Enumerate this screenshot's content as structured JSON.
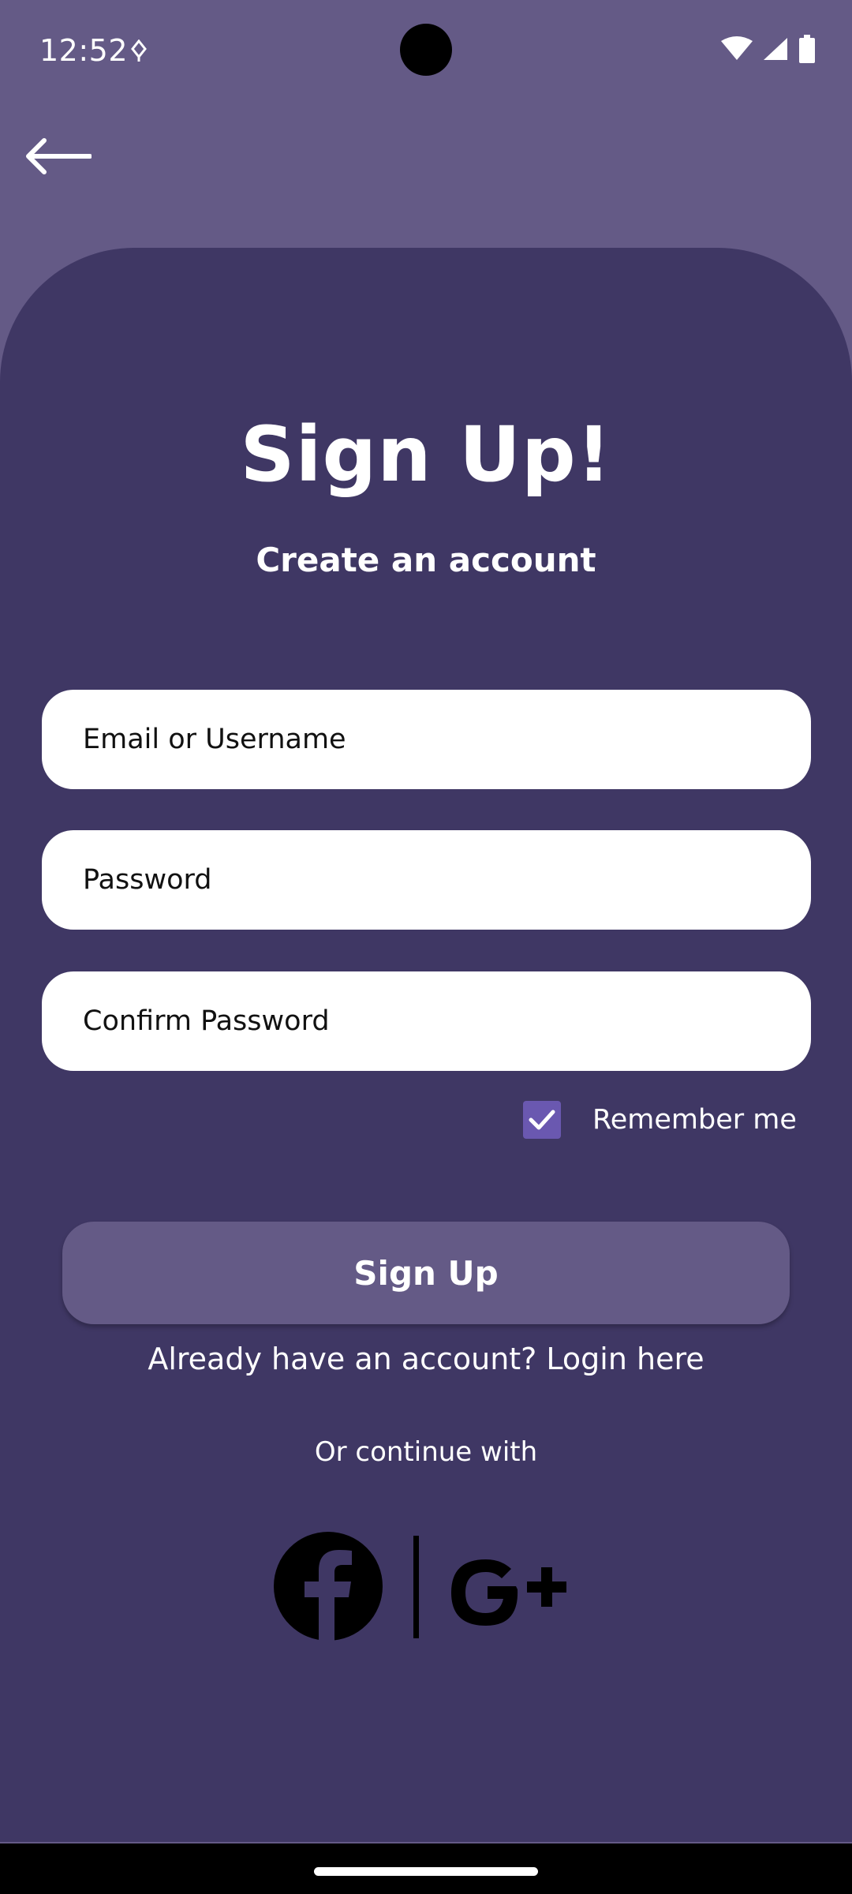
{
  "status_bar": {
    "time": "12:52"
  },
  "header": {
    "back_icon": "arrow-left-icon"
  },
  "signup": {
    "title": "Sign Up!",
    "subtitle": "Create an account",
    "email_placeholder": "Email or Username",
    "email_value": "",
    "password_placeholder": "Password",
    "password_value": "",
    "confirm_placeholder": "Confirm Password",
    "confirm_value": "",
    "remember_label": "Remember me",
    "remember_checked": true,
    "button_label": "Sign Up",
    "login_prompt": "Already have an account? Login here",
    "continue_text": "Or continue with"
  },
  "social": {
    "icons": [
      "facebook-icon",
      "google-plus-icon"
    ]
  },
  "colors": {
    "background": "#645a86",
    "card": "#3f3764",
    "checkbox": "#6a58b0",
    "button": "#645a86"
  }
}
